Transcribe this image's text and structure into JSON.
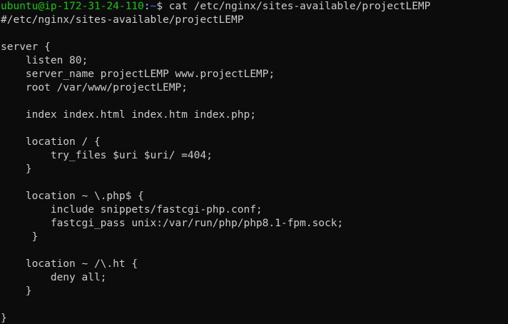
{
  "terminal": {
    "prompt": {
      "user_host": "ubuntu@ip-172-31-24-110",
      "separator": ":",
      "path": "~",
      "symbol": "$ ",
      "command": "cat /etc/nginx/sites-available/projectLEMP"
    },
    "output_lines": [
      "#/etc/nginx/sites-available/projectLEMP",
      "",
      "server {",
      "    listen 80;",
      "    server_name projectLEMP www.projectLEMP;",
      "    root /var/www/projectLEMP;",
      "",
      "    index index.html index.htm index.php;",
      "",
      "    location / {",
      "        try_files $uri $uri/ =404;",
      "    }",
      "",
      "    location ~ \\.php$ {",
      "        include snippets/fastcgi-php.conf;",
      "        fastcgi_pass unix:/var/run/php/php8.1-fpm.sock;",
      "     }",
      "",
      "    location ~ /\\.ht {",
      "        deny all;",
      "    }",
      "",
      "}"
    ],
    "colors": {
      "background": "#0c0c0c",
      "text": "#cccccc",
      "prompt_user": "#16c60c",
      "prompt_path": "#3b78ff"
    }
  }
}
